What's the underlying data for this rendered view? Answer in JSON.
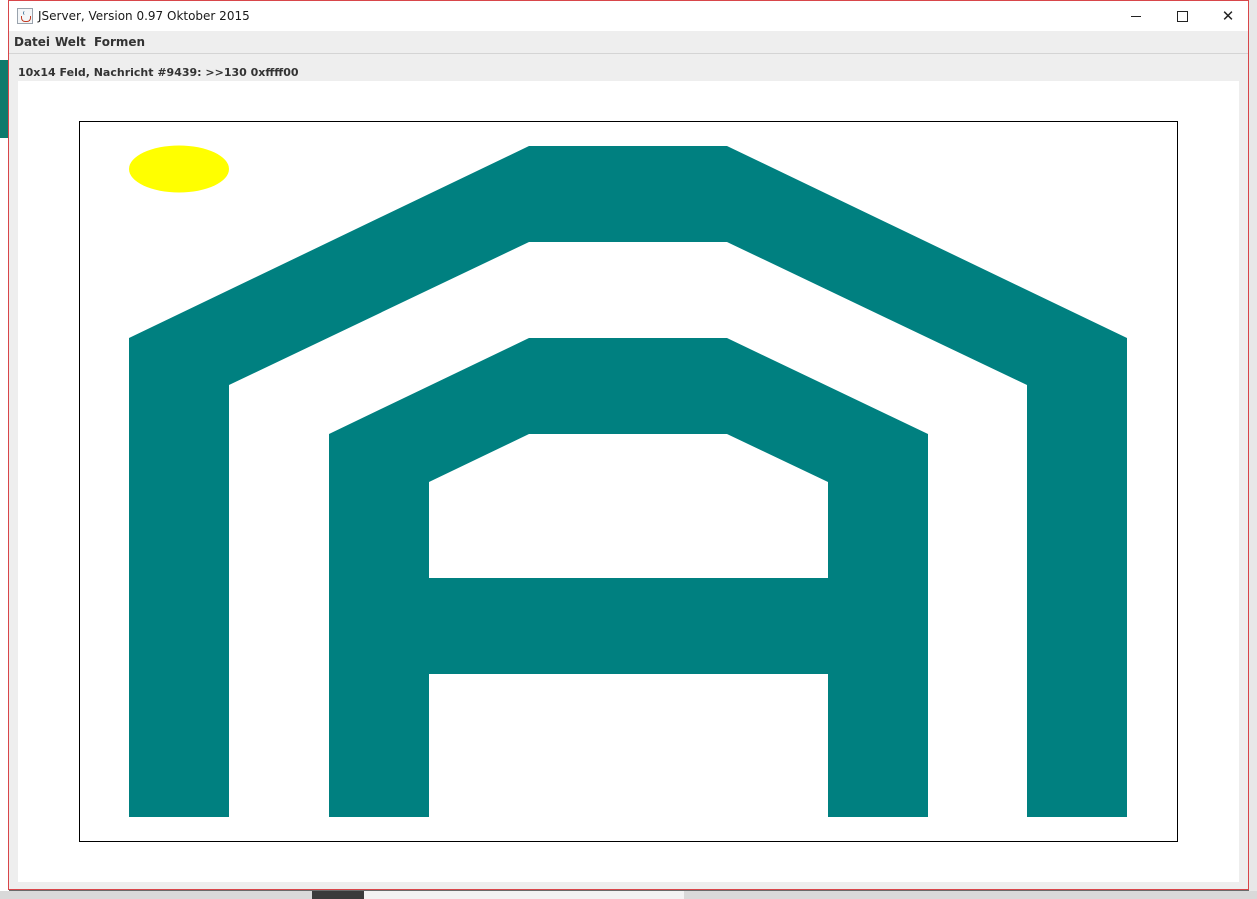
{
  "window": {
    "title": "JServer, Version 0.97 Oktober 2015"
  },
  "menu": {
    "items": [
      "Datei",
      "Welt",
      "Formen"
    ]
  },
  "status": {
    "text": "10x14 Feld, Nachricht #9439: >>130 0xffff00"
  },
  "icons": {
    "app": "java-cup-icon",
    "minimize": "minimize-icon",
    "maximize": "maximize-icon",
    "close": "close-icon"
  },
  "colors": {
    "shape": "#008080",
    "circle": "#ffff00",
    "board_border": "#000000",
    "board_background": "#ffffff"
  }
}
